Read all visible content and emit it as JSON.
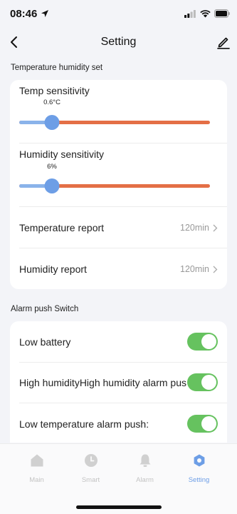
{
  "status_bar": {
    "time": "08:46"
  },
  "nav": {
    "title": "Setting"
  },
  "section_sensors": {
    "title": "Temperature humidity set"
  },
  "sliders": [
    {
      "label": "Temp sensitivity",
      "value_text": "0.6°C",
      "fraction": 0.17
    },
    {
      "label": "Humidity sensitivity",
      "value_text": "6%",
      "fraction": 0.17
    }
  ],
  "reports": [
    {
      "label": "Temperature report",
      "value": "120min"
    },
    {
      "label": "Humidity report",
      "value": "120min"
    }
  ],
  "section_alarm": {
    "title": "Alarm push Switch"
  },
  "switches": [
    {
      "label": "Low battery",
      "on": true
    },
    {
      "label": "High humidityHigh humidity alarm push",
      "on": true
    },
    {
      "label": "Low temperature alarm push:",
      "on": true
    }
  ],
  "tabs": [
    {
      "label": "Main",
      "icon": "home-icon",
      "active": false
    },
    {
      "label": "Smart",
      "icon": "clock-icon",
      "active": false
    },
    {
      "label": "Alarm",
      "icon": "bell-icon",
      "active": false
    },
    {
      "label": "Setting",
      "icon": "gear-icon",
      "active": true
    }
  ],
  "colors": {
    "accent_blue": "#6d9ee6",
    "slider_track": "#e46f46",
    "toggle_on": "#66c25f",
    "tab_inactive": "#c3c3c3"
  }
}
